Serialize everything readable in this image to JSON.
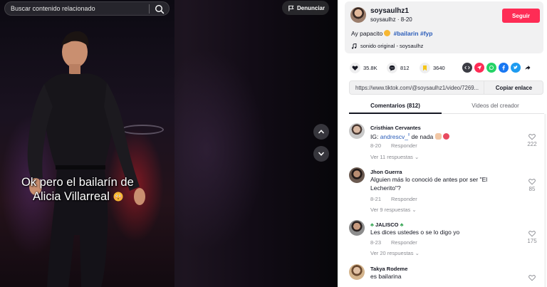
{
  "search": {
    "placeholder": "Buscar contenido relacionado"
  },
  "video": {
    "report_label": "Denunciar",
    "caption_line1": "Ok pero el bailarín de",
    "caption_line2": "Alicia Villarreal"
  },
  "creator": {
    "username": "soysaulhz1",
    "handle": "soysaulhz",
    "separator": "·",
    "date": "8-20",
    "follow_label": "Seguir",
    "description_prefix": "Ay papacito",
    "hashtags": [
      "#bailarin",
      "#fyp"
    ],
    "music": "sonido original - soysaulhz"
  },
  "stats": {
    "likes": "35.8K",
    "comments": "812",
    "saves": "3640"
  },
  "share_icons": [
    "embed-icon",
    "send-icon",
    "whatsapp-icon",
    "facebook-icon",
    "twitter-icon",
    "share-icon"
  ],
  "colors": {
    "follow": "#fe2c55",
    "hashtag": "#2b5db9",
    "whatsapp": "#25d366",
    "facebook": "#1877f2",
    "twitter": "#1d9bf0",
    "send": "#fe2c55",
    "save": "#f5c518"
  },
  "link": {
    "url": "https://www.tiktok.com/@soysaulhz1/video/7269...",
    "copy_label": "Copiar enlace"
  },
  "tabs": {
    "comments": "Comentarios (812)",
    "videos": "Videos del creador"
  },
  "comments": [
    {
      "name": "Cristhian Cervantes",
      "text_prefix": "IG: ",
      "mention": "andrescv_",
      "mention_sup": "ᵍ",
      "text_suffix": " de nada",
      "date": "8-20",
      "reply_label": "Responder",
      "likes": "222",
      "more": "Ver 11 respuestas"
    },
    {
      "name": "Jhon Guerra",
      "text": "Alguien más lo conoció de antes por ser \"El Lecherito\"?",
      "date": "8-21",
      "reply_label": "Responder",
      "likes": "85",
      "more": "Ver 9 respuestas"
    },
    {
      "name": "JALISCO",
      "text": "Les dices ustedes o se lo digo yo",
      "date": "8-23",
      "reply_label": "Responder",
      "likes": "175",
      "more": "Ver 20 respuestas"
    },
    {
      "name": "Takya Rodeme",
      "text": "es bailarina"
    }
  ]
}
